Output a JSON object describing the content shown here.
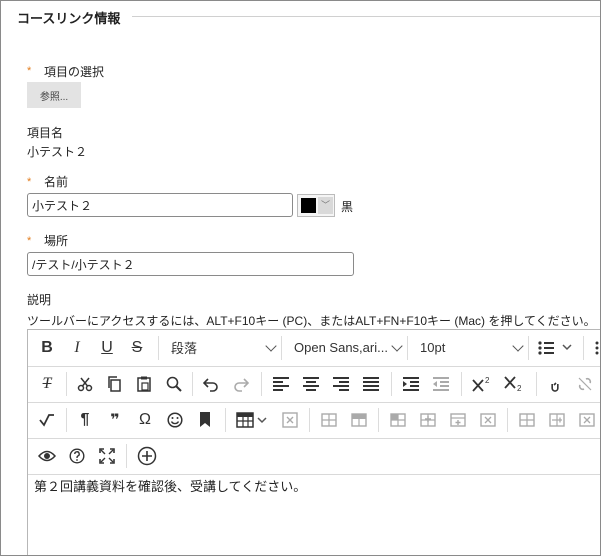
{
  "fieldset": {
    "title": "コースリンク情報"
  },
  "item_select": {
    "label": "項目の選択",
    "browse_label": "参照..."
  },
  "item_name": {
    "label": "項目名",
    "value": "小テスト２"
  },
  "name": {
    "label": "名前",
    "value": "小テスト２",
    "color_label": "黒",
    "color": "#000000"
  },
  "location": {
    "label": "場所",
    "value": "/テスト/小テスト２"
  },
  "description": {
    "label": "説明",
    "hint": "ツールバーにアクセスするには、ALT+F10キー (PC)、またはALT+FN+F10キー (Mac) を押してください。"
  },
  "toolbar": {
    "paragraph_label": "段落",
    "font_label": "Open Sans,ari...",
    "size_label": "10pt",
    "bold": "B",
    "italic": "I",
    "underline": "U",
    "strike": "S",
    "clear": "T",
    "pilcrow": "¶",
    "quote": "❞",
    "omega": "Ω"
  },
  "editor": {
    "content": "第２回講義資料を確認後、受講してください。"
  }
}
